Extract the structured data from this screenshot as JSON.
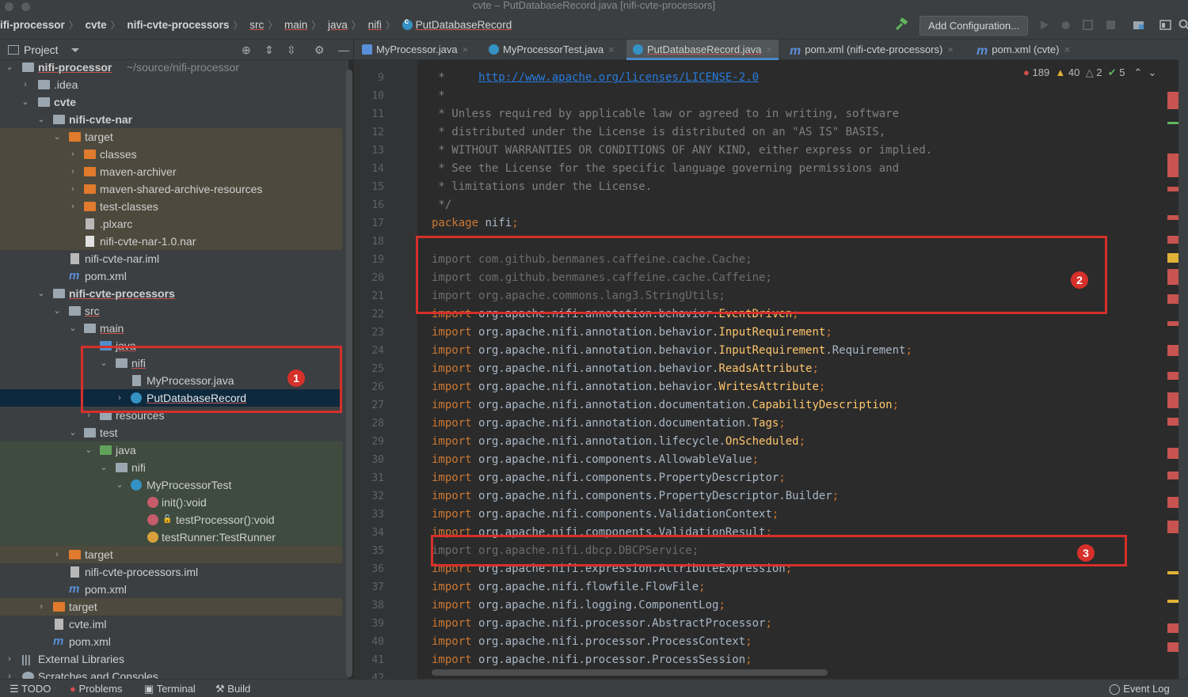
{
  "window": {
    "title": "cvte – PutDatabaseRecord.java [nifi-cvte-processors]"
  },
  "breadcrumb": [
    "ifi-processor",
    "cvte",
    "nifi-cvte-processors",
    "src",
    "main",
    "java",
    "nifi",
    "PutDatabaseRecord"
  ],
  "toolbar": {
    "add_configuration": "Add Configuration..."
  },
  "project_panel": {
    "title": "Project"
  },
  "tree": [
    {
      "label": "nifi-processor",
      "extra": "~/source/nifi-processor"
    },
    {
      "label": ".idea"
    },
    {
      "label": "cvte"
    },
    {
      "label": "nifi-cvte-nar"
    },
    {
      "label": "target"
    },
    {
      "label": "classes"
    },
    {
      "label": "maven-archiver"
    },
    {
      "label": "maven-shared-archive-resources"
    },
    {
      "label": "test-classes"
    },
    {
      "label": ".plxarc"
    },
    {
      "label": "nifi-cvte-nar-1.0.nar"
    },
    {
      "label": "nifi-cvte-nar.iml"
    },
    {
      "label": "pom.xml"
    },
    {
      "label": "nifi-cvte-processors"
    },
    {
      "label": "src"
    },
    {
      "label": "main"
    },
    {
      "label": "java"
    },
    {
      "label": "nifi"
    },
    {
      "label": "MyProcessor.java"
    },
    {
      "label": "PutDatabaseRecord"
    },
    {
      "label": "resources"
    },
    {
      "label": "test"
    },
    {
      "label": "java"
    },
    {
      "label": "nifi"
    },
    {
      "label": "MyProcessorTest"
    },
    {
      "label": "init():void"
    },
    {
      "label": "testProcessor():void"
    },
    {
      "label": "testRunner:TestRunner"
    },
    {
      "label": "target"
    },
    {
      "label": "nifi-cvte-processors.iml"
    },
    {
      "label": "pom.xml"
    },
    {
      "label": "target"
    },
    {
      "label": "cvte.iml"
    },
    {
      "label": "pom.xml"
    },
    {
      "label": "External Libraries"
    },
    {
      "label": "Scratches and Consoles"
    }
  ],
  "tabs": [
    {
      "label": "MyProcessor.java"
    },
    {
      "label": "MyProcessorTest.java"
    },
    {
      "label": "PutDatabaseRecord.java"
    },
    {
      "label": "pom.xml (nifi-cvte-processors)"
    },
    {
      "label": "pom.xml (cvte)"
    }
  ],
  "inspections": {
    "errors": "189",
    "warnings": "40",
    "weak_warnings": "2",
    "ok": "5"
  },
  "line_numbers": [
    "9",
    "10",
    "11",
    "12",
    "13",
    "14",
    "15",
    "16",
    "17",
    "18",
    "19",
    "20",
    "21",
    "22",
    "23",
    "24",
    "25",
    "26",
    "27",
    "28",
    "29",
    "30",
    "31",
    "32",
    "33",
    "34",
    "35",
    "36",
    "37",
    "38",
    "39",
    "40",
    "41",
    "42"
  ],
  "code": {
    "l9": "http://www.apache.org/licenses/LICENSE-2.0",
    "l11": " * Unless required by applicable law or agreed to in writing, software",
    "l12": " * distributed under the License is distributed on an \"AS IS\" BASIS,",
    "l13": " * WITHOUT WARRANTIES OR CONDITIONS OF ANY KIND, either express or implied.",
    "l14": " * See the License for the specific language governing permissions and",
    "l15": " * limitations under the License.",
    "l16": " */",
    "l17_pkg": "nifi",
    "l19": "import com.github.benmanes.caffeine.cache.Cache;",
    "l20": "import com.github.benmanes.caffeine.cache.Caffeine;",
    "l21": "import org.apache.commons.lang3.StringUtils;",
    "l22_pre": "org.apache.nifi.annotation.behavior.",
    "l22_cls": "EventDriven",
    "l23_pre": "org.apache.nifi.annotation.behavior.",
    "l23_cls": "InputRequirement",
    "l24_pre": "org.apache.nifi.annotation.behavior.",
    "l24_cls": "InputRequirement",
    "l24_post": ".Requirement",
    "l25_pre": "org.apache.nifi.annotation.behavior.",
    "l25_cls": "ReadsAttribute",
    "l26_pre": "org.apache.nifi.annotation.behavior.",
    "l26_cls": "WritesAttribute",
    "l27_pre": "org.apache.nifi.annotation.documentation.",
    "l27_cls": "CapabilityDescription",
    "l28_pre": "org.apache.nifi.annotation.documentation.",
    "l28_cls": "Tags",
    "l29_pre": "org.apache.nifi.annotation.lifecycle.",
    "l29_cls": "OnScheduled",
    "l30": "org.apache.nifi.components.AllowableValue",
    "l31": "org.apache.nifi.components.PropertyDescriptor",
    "l32": "org.apache.nifi.components.PropertyDescriptor.Builder",
    "l33": "org.apache.nifi.components.ValidationContext",
    "l34": "org.apache.nifi.components.ValidationResult",
    "l35": "import org.apache.nifi.dbcp.DBCPService;",
    "l36": "org.apache.nifi.expression.AttributeExpression",
    "l37": "org.apache.nifi.flowfile.FlowFile",
    "l38": "org.apache.nifi.logging.ComponentLog",
    "l39": "org.apache.nifi.processor.AbstractProcessor",
    "l40": "org.apache.nifi.processor.ProcessContext",
    "l41": "org.apache.nifi.processor.ProcessSession"
  },
  "annotations": [
    "1",
    "2",
    "3"
  ],
  "statusbar": {
    "todo": "TODO",
    "problems": "Problems",
    "terminal": "Terminal",
    "build": "Build",
    "event_log": "Event Log"
  },
  "colors": {
    "accent": "#4a88c7",
    "annotation": "#d6302a",
    "keyword": "#cc7832",
    "class_ref": "#ffc66d"
  }
}
